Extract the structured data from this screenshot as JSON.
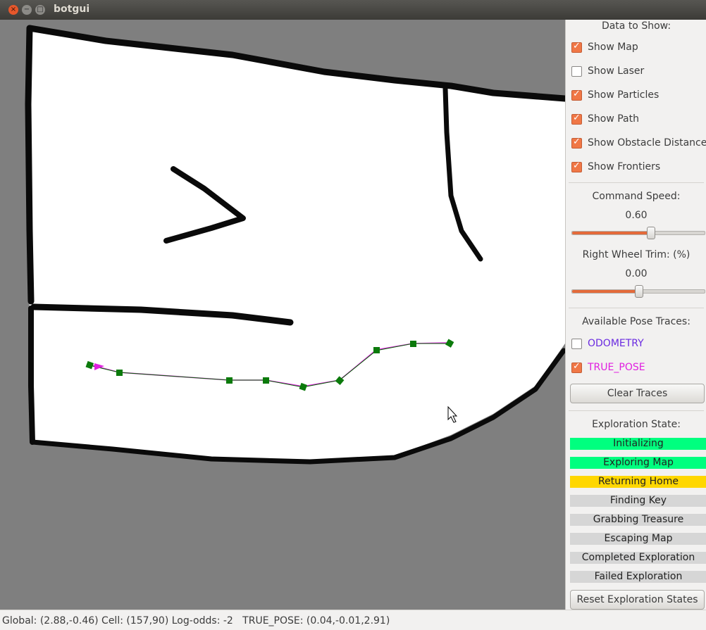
{
  "window": {
    "title": "botgui"
  },
  "panel": {
    "data_heading": "Data to Show:",
    "checks": [
      {
        "label": "Show Map",
        "checked": true
      },
      {
        "label": "Show Laser",
        "checked": false
      },
      {
        "label": "Show Particles",
        "checked": true
      },
      {
        "label": "Show Path",
        "checked": true
      },
      {
        "label": "Show Obstacle Distances",
        "checked": true
      },
      {
        "label": "Show Frontiers",
        "checked": true
      }
    ],
    "speed": {
      "label": "Command Speed:",
      "value": "0.60",
      "fraction": 0.59
    },
    "trim": {
      "label": "Right Wheel Trim: (%)",
      "value": "0.00",
      "fraction": 0.5
    },
    "traces": {
      "heading": "Available Pose Traces:",
      "items": [
        {
          "label": "ODOMETRY",
          "checked": false,
          "color": "#6a2be0"
        },
        {
          "label": "TRUE_POSE",
          "checked": true,
          "color": "#e020e0"
        }
      ],
      "clear_label": "Clear Traces"
    },
    "exploration": {
      "heading": "Exploration State:",
      "states": [
        {
          "label": "Initializing",
          "color": "#00ff7f"
        },
        {
          "label": "Exploring Map",
          "color": "#00ff7f"
        },
        {
          "label": "Returning Home",
          "color": "#ffd700"
        },
        {
          "label": "Finding Key",
          "color": "#d6d6d6"
        },
        {
          "label": "Grabbing Treasure",
          "color": "#d6d6d6"
        },
        {
          "label": "Escaping Map",
          "color": "#d6d6d6"
        },
        {
          "label": "Completed Exploration",
          "color": "#d6d6d6"
        },
        {
          "label": "Failed Exploration",
          "color": "#d6d6d6"
        }
      ],
      "reset_label": "Reset Exploration States"
    }
  },
  "status": {
    "text": "Global: (2.88,-0.46) Cell: (157,90) Log-odds: -2   TRUE_POSE: (0.04,-0.01,2.91)"
  },
  "colors": {
    "free": "#ffffff",
    "wall": "#000000",
    "unknown": "#7f7f7f",
    "path": "#006400",
    "true_pose": "#e020e0",
    "accent": "#f07746"
  }
}
